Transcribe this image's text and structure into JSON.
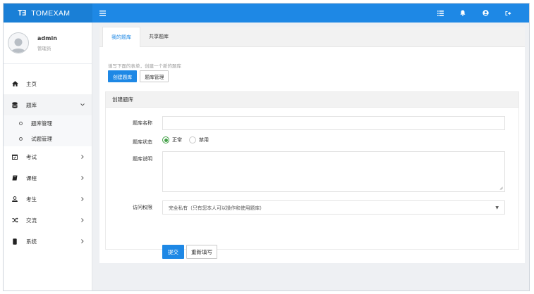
{
  "brand": {
    "mark": "T∃",
    "name": "TOMEXAM"
  },
  "user": {
    "name": "admin",
    "role": "管理员"
  },
  "nav": {
    "home": "主页",
    "bank": "题库",
    "bank_manage": "题库管理",
    "question_manage": "试题管理",
    "exam": "考试",
    "course": "课程",
    "student": "考生",
    "exchange": "交流",
    "system": "系统"
  },
  "tabs": {
    "mine": "我的题库",
    "shared": "共享题库"
  },
  "hint": "填写下面的表单，创建一个新的题库",
  "buttons": {
    "create": "创建题库",
    "manage": "题库管理"
  },
  "panel": {
    "title": "创建题库"
  },
  "form": {
    "name_label": "题库名称",
    "name_value": "",
    "status_label": "题库状态",
    "status_normal": "正常",
    "status_disabled": "禁用",
    "desc_label": "题库说明",
    "desc_value": "",
    "access_label": "访问权限",
    "access_value": "完全私有（只有您本人可以操作和使用题库）",
    "submit": "提交",
    "reset": "重新填写"
  },
  "colors": {
    "primary": "#1e88e5",
    "radio": "#43a047"
  }
}
